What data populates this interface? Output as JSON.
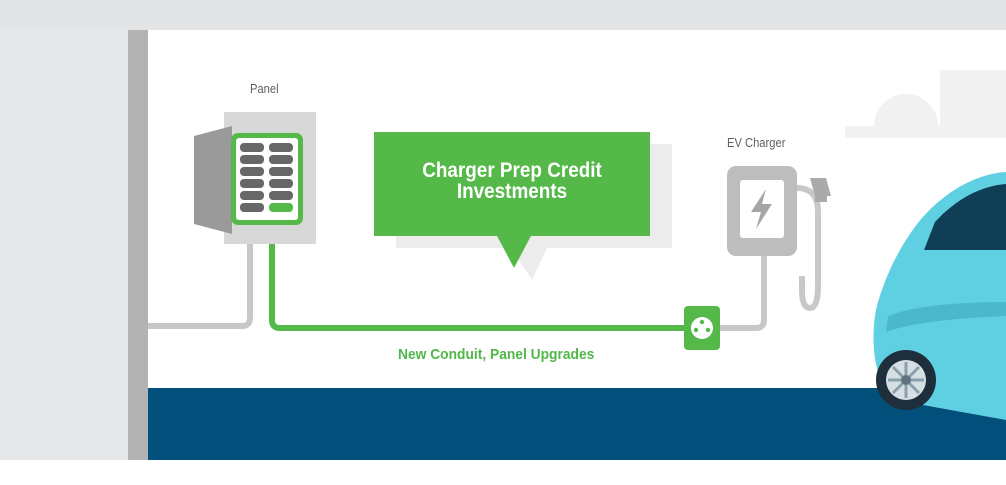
{
  "panel": {
    "label": "Panel"
  },
  "callout": {
    "line1": "Charger Prep Credit",
    "line2": "Investments"
  },
  "charger": {
    "label": "EV Charger"
  },
  "conduit": {
    "label": "New Conduit, Panel Upgrades"
  },
  "colors": {
    "accent_green": "#54b948",
    "floor_blue": "#04507c",
    "wall_gray": "#b3b3b3",
    "cable_gray": "#bdbdbd",
    "car_teal": "#5fcfe2"
  },
  "icons": [
    "breaker-panel-icon",
    "lightning-bolt-icon",
    "power-outlet-icon",
    "charging-plug-icon",
    "car-icon"
  ]
}
